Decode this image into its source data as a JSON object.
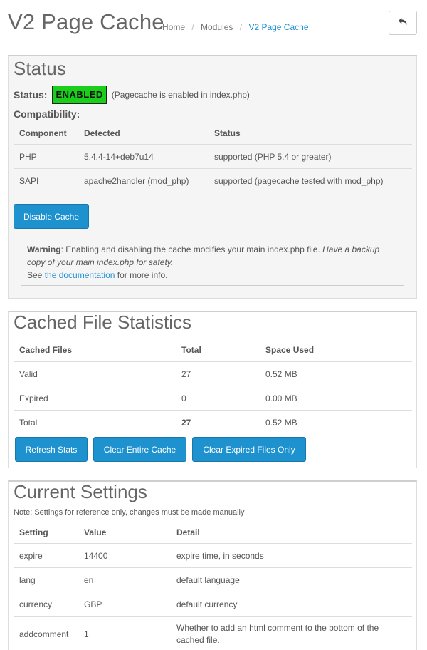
{
  "header": {
    "title": "V2 Page Cache",
    "breadcrumb": [
      "Home",
      "Modules",
      "V2 Page Cache"
    ],
    "back_icon": "reply-arrow-icon"
  },
  "status_panel": {
    "heading": "Status",
    "status_label": "Status:",
    "status_badge": "ENABLED",
    "status_badge_color": "#19cf19",
    "status_note": "(Pagecache is enabled in index.php)",
    "compat_label": "Compatibility:",
    "compat_table": {
      "headers": [
        "Component",
        "Detected",
        "Status"
      ],
      "rows": [
        [
          "PHP",
          "5.4.4-14+deb7u14",
          "supported (PHP 5.4 or greater)"
        ],
        [
          "SAPI",
          "apache2handler (mod_php)",
          "supported (pagecache tested with mod_php)"
        ]
      ]
    },
    "disable_button": "Disable Cache",
    "warning": {
      "label": "Warning",
      "text": ": Enabling and disabling the cache modifies your main index.php file. ",
      "italic": "Have a backup copy of your main index.php for safety.",
      "see": "See ",
      "link": "the documentation",
      "after_link": " for more info."
    }
  },
  "stats_panel": {
    "heading": "Cached File Statistics",
    "table": {
      "headers": [
        "Cached Files",
        "Total",
        "Space Used"
      ],
      "rows": [
        [
          "Valid",
          "27",
          "0.52 MB"
        ],
        [
          "Expired",
          "0",
          "0.00 MB"
        ],
        [
          "Total",
          "27",
          "0.52 MB"
        ]
      ]
    },
    "buttons": [
      "Refresh Stats",
      "Clear Entire Cache",
      "Clear Expired Files Only"
    ]
  },
  "settings_panel": {
    "heading": "Current Settings",
    "note": "Note: Settings for reference only, changes must be made manually",
    "table": {
      "headers": [
        "Setting",
        "Value",
        "Detail"
      ],
      "rows": [
        [
          "expire",
          "14400",
          "expire time, in seconds"
        ],
        [
          "lang",
          "en",
          "default language"
        ],
        [
          "currency",
          "GBP",
          "default currency"
        ],
        [
          "addcomment",
          "1",
          "Whether to add an html comment to the bottom of the cached file."
        ]
      ]
    }
  },
  "colors": {
    "accent": "#1e91cf",
    "panel_bg": "#f5f5f5",
    "enabled_green": "#19cf19"
  }
}
